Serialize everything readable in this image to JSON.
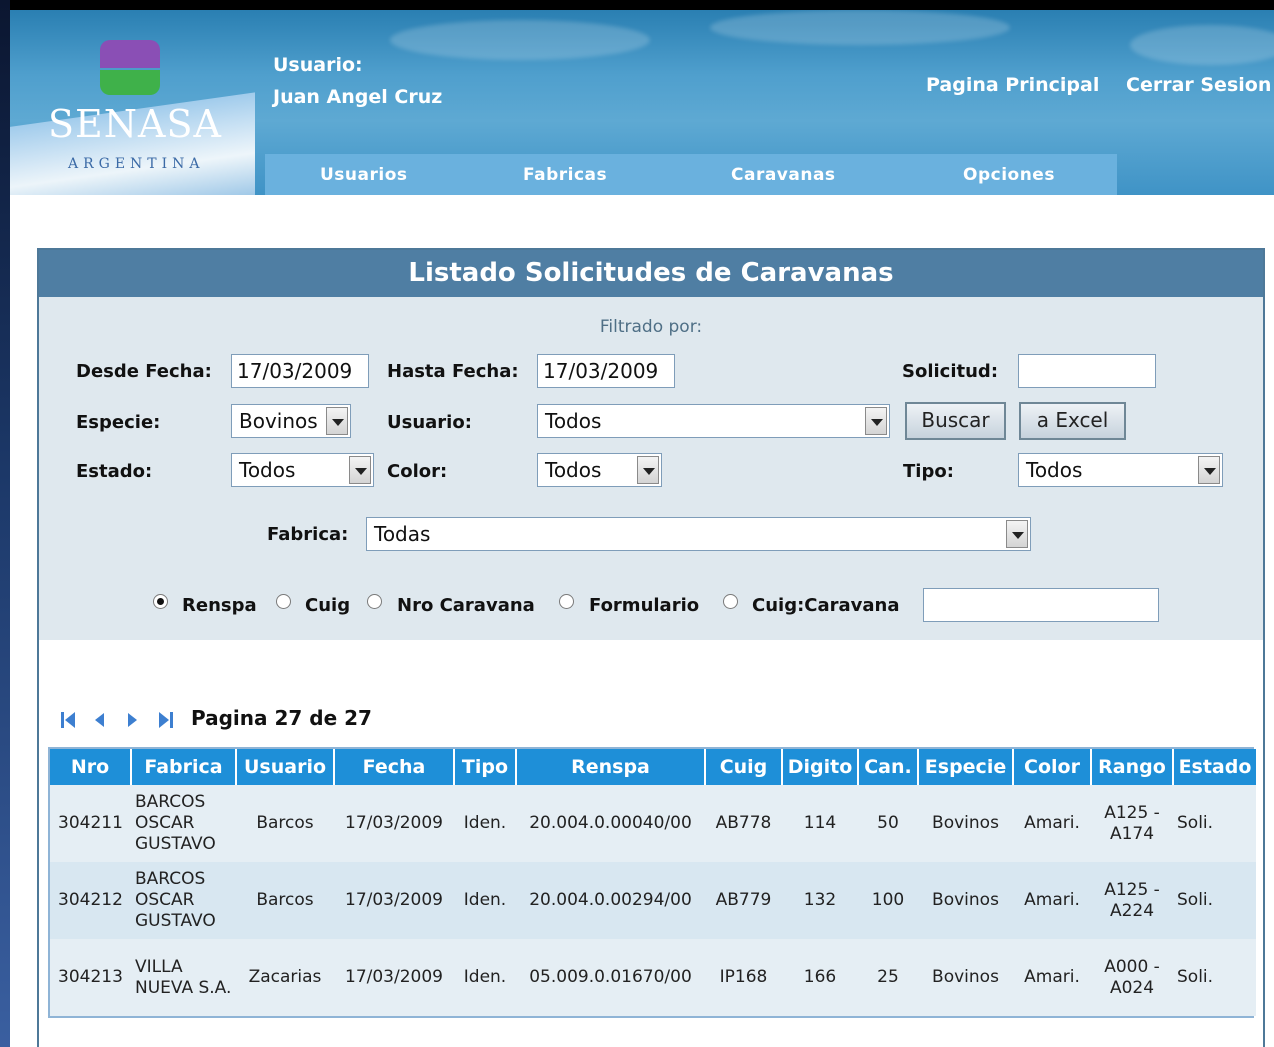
{
  "brand": {
    "name": "SENASA",
    "subtitle": "ARGENTINA"
  },
  "user": {
    "label": "Usuario:",
    "name": "Juan Angel Cruz"
  },
  "top_links": {
    "home": "Pagina Principal",
    "logout": "Cerrar Sesion"
  },
  "nav": [
    "Usuarios",
    "Fabricas",
    "Caravanas",
    "Opciones"
  ],
  "panel": {
    "title": "Listado Solicitudes de Caravanas",
    "filtered_by": "Filtrado por:"
  },
  "filters": {
    "desde_fecha": {
      "label": "Desde Fecha:",
      "value": "17/03/2009"
    },
    "hasta_fecha": {
      "label": "Hasta Fecha:",
      "value": "17/03/2009"
    },
    "solicitud": {
      "label": "Solicitud:",
      "value": ""
    },
    "especie": {
      "label": "Especie:",
      "value": "Bovinos"
    },
    "usuario": {
      "label": "Usuario:",
      "value": "Todos"
    },
    "estado": {
      "label": "Estado:",
      "value": "Todos"
    },
    "color": {
      "label": "Color:",
      "value": "Todos"
    },
    "tipo": {
      "label": "Tipo:",
      "value": "Todos"
    },
    "fabrica": {
      "label": "Fabrica:",
      "value": "Todas"
    },
    "search_text": "",
    "buttons": {
      "buscar": "Buscar",
      "excel": "a Excel"
    },
    "radios": [
      {
        "label": "Renspa",
        "checked": true
      },
      {
        "label": "Cuig",
        "checked": false
      },
      {
        "label": "Nro Caravana",
        "checked": false
      },
      {
        "label": "Formulario",
        "checked": false
      },
      {
        "label": "Cuig:Caravana",
        "checked": false
      }
    ]
  },
  "pager": {
    "text": "Pagina 27 de 27",
    "current_page": 27,
    "total_pages": 27
  },
  "table": {
    "columns": [
      "Nro",
      "Fabrica",
      "Usuario",
      "Fecha",
      "Tipo",
      "Renspa",
      "Cuig",
      "Digito",
      "Can.",
      "Especie",
      "Color",
      "Rango",
      "Estado"
    ],
    "rows": [
      [
        "304211",
        "BARCOS OSCAR GUSTAVO",
        "Barcos",
        "17/03/2009",
        "Iden.",
        "20.004.0.00040/00",
        "AB778",
        "114",
        "50",
        "Bovinos",
        "Amari.",
        "A125 - A174",
        "Soli."
      ],
      [
        "304212",
        "BARCOS OSCAR GUSTAVO",
        "Barcos",
        "17/03/2009",
        "Iden.",
        "20.004.0.00294/00",
        "AB779",
        "132",
        "100",
        "Bovinos",
        "Amari.",
        "A125 - A224",
        "Soli."
      ],
      [
        "304213",
        "VILLA NUEVA S.A.",
        "Zacarias",
        "17/03/2009",
        "Iden.",
        "05.009.0.01670/00",
        "IP168",
        "166",
        "25",
        "Bovinos",
        "Amari.",
        "A000 - A024",
        "Soli."
      ]
    ]
  },
  "colors": {
    "header": "#4f9fcd",
    "nav": "#6ab1de",
    "panel_title": "#4f7ea3",
    "table_header": "#1e8fd8"
  },
  "icons": [
    "first-page-icon",
    "prev-page-icon",
    "next-page-icon",
    "last-page-icon"
  ]
}
